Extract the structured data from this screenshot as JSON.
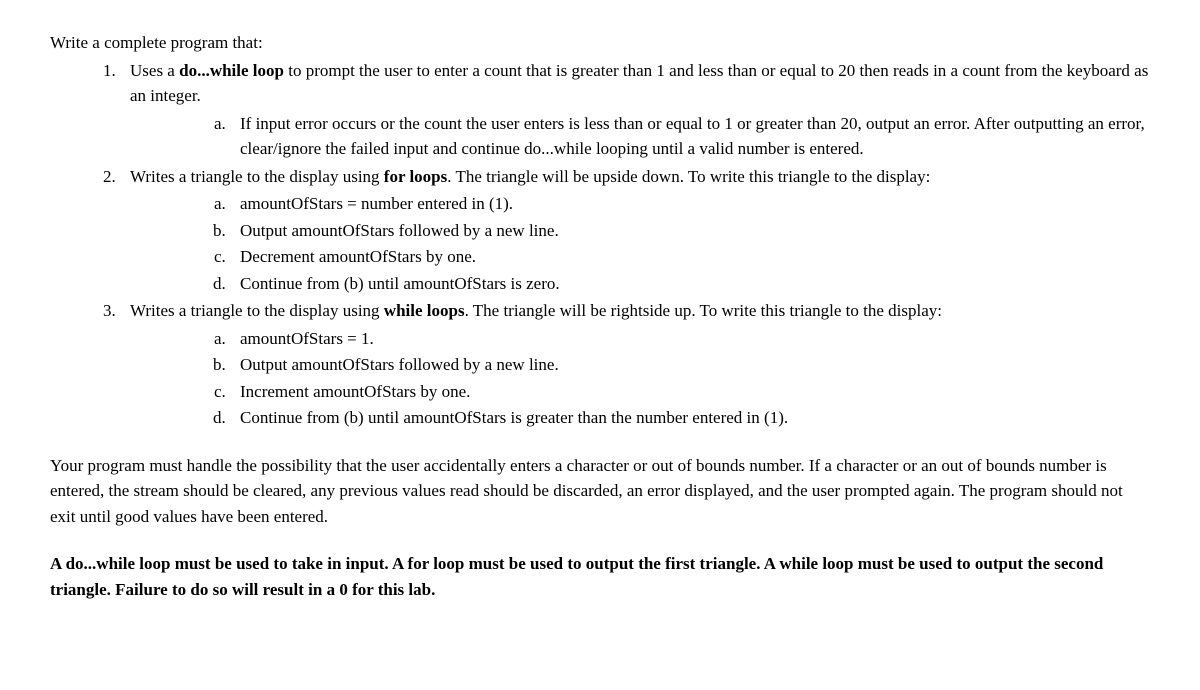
{
  "intro": "Write a complete program that:",
  "items": {
    "i1": {
      "text_before": "Uses a ",
      "bold": "do...while loop",
      "text_after": " to prompt the user to enter a count that is greater than 1 and less than or equal to 20 then reads in a count from the keyboard as an integer.",
      "sub": {
        "a": "If input error occurs or the count the user enters is less than or equal to 1 or greater than 20, output an error. After outputting an error, clear/ignore the failed input and continue do...while looping until a valid number is entered."
      }
    },
    "i2": {
      "text_before": "Writes a triangle to the display using ",
      "bold": "for loops",
      "text_after": ". The triangle will be upside down. To write this triangle to the display:",
      "sub": {
        "a": "amountOfStars = number entered in (1).",
        "b": "Output amountOfStars followed by a new line.",
        "c": "Decrement amountOfStars by one.",
        "d": "Continue from (b) until amountOfStars is zero."
      }
    },
    "i3": {
      "text_before": "Writes a triangle to the display using ",
      "bold": "while loops",
      "text_after": ". The triangle will be rightside up. To write this triangle to the display:",
      "sub": {
        "a": "amountOfStars = 1.",
        "b": "Output amountOfStars followed by a new line.",
        "c": "Increment amountOfStars by one.",
        "d": "Continue from (b) until amountOfStars is greater than the number entered in (1)."
      }
    }
  },
  "para1": "Your program must handle the possibility that the user accidentally enters a character or out of bounds number.  If a character or an out of bounds number is entered, the stream should be cleared, any previous values read should be discarded, an error displayed, and the user prompted again. The program should not exit until good values have been entered.",
  "para2": "A do...while loop must be used to take in input. A for loop must be used to output the first triangle. A while loop must be used to output the second triangle. Failure to do so will result in a 0 for this lab."
}
